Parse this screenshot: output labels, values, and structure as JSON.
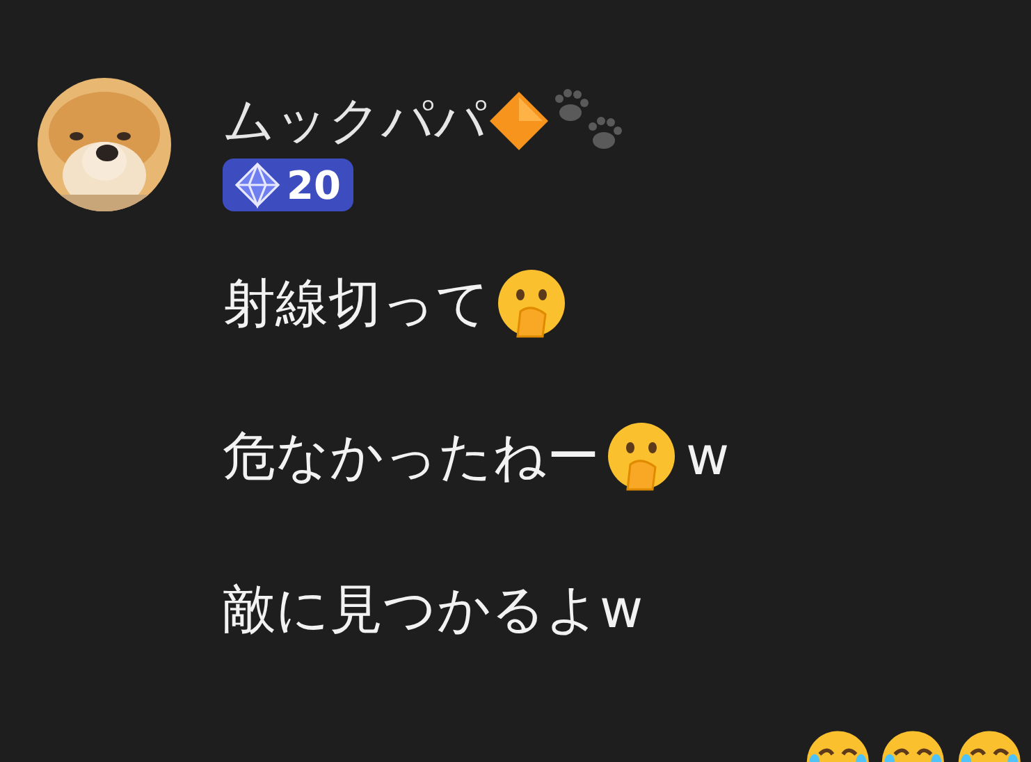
{
  "user": {
    "name": "ムックパパ",
    "name_icons": [
      {
        "kind": "diamond"
      },
      {
        "kind": "paws"
      }
    ],
    "badge": {
      "count": "20"
    }
  },
  "messages": [
    {
      "parts": [
        {
          "kind": "text",
          "text": "射線切って"
        },
        {
          "kind": "hush"
        }
      ]
    },
    {
      "parts": [
        {
          "kind": "text",
          "text": "危なかったねー"
        },
        {
          "kind": "hush"
        },
        {
          "kind": "text",
          "text": "w"
        }
      ]
    },
    {
      "parts": [
        {
          "kind": "text",
          "text": "敵に見つかるよw"
        }
      ]
    },
    {
      "parts": [
        {
          "kind": "laugh"
        },
        {
          "kind": "laugh"
        },
        {
          "kind": "laugh"
        }
      ]
    }
  ]
}
